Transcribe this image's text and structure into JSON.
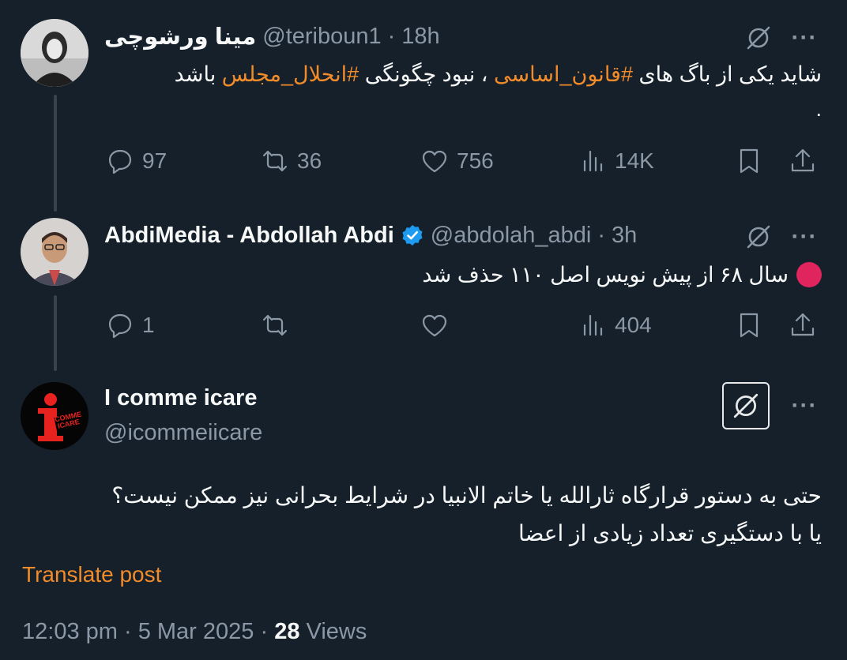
{
  "tweet1": {
    "display_name": "مینا ورشوچی",
    "handle": "@teriboun1",
    "separator": "·",
    "time": "18h",
    "text_part1": "شاید یکی از باگ های ",
    "hashtag1": "#قانون_اساسی",
    "text_part2": " ، نبود چگونگی ",
    "hashtag2": "#انحلال_مجلس",
    "text_part3": " باشد",
    "text_line2": ".",
    "replies": "97",
    "reposts": "36",
    "likes": "756",
    "views": "14K"
  },
  "tweet2": {
    "display_name": "AbdiMedia - Abdollah Abdi",
    "handle": "@abdolah_abdi",
    "separator": "·",
    "time": "3h",
    "text": "سال ۶۸ از پیش نویس اصل ۱۱۰ حذف شد",
    "replies": "1",
    "reposts": "",
    "likes": "",
    "views": "404"
  },
  "tweet3": {
    "display_name": "I comme icare",
    "handle": "@icommeiicare",
    "avatar_text": "COMME ICARE",
    "text_line1": "حتی به دستور قرارگاه ثارالله یا خاتم الانبیا در شرایط بحرانی نیز ممکن نیست؟",
    "text_line2": "یا با دستگیری تعداد زیادی از اعضا",
    "translate_label": "Translate post",
    "footer_time": "12:03 pm",
    "footer_sep1": " · ",
    "footer_date": "5 Mar 2025",
    "footer_sep2": " · ",
    "footer_views_count": "28",
    "footer_views_label": " Views"
  },
  "icons": {
    "grok": "grok-icon",
    "more": "more-icon",
    "reply": "reply-icon",
    "repost": "repost-icon",
    "like": "heart-icon",
    "views": "views-icon",
    "bookmark": "bookmark-icon",
    "share": "share-icon",
    "verified": "verified-badge-icon"
  },
  "colors": {
    "background": "#15202b",
    "accent": "#f28b2a",
    "muted": "#8b98a5",
    "verified": "#1d9bf0",
    "red_circle": "#e0245e"
  }
}
